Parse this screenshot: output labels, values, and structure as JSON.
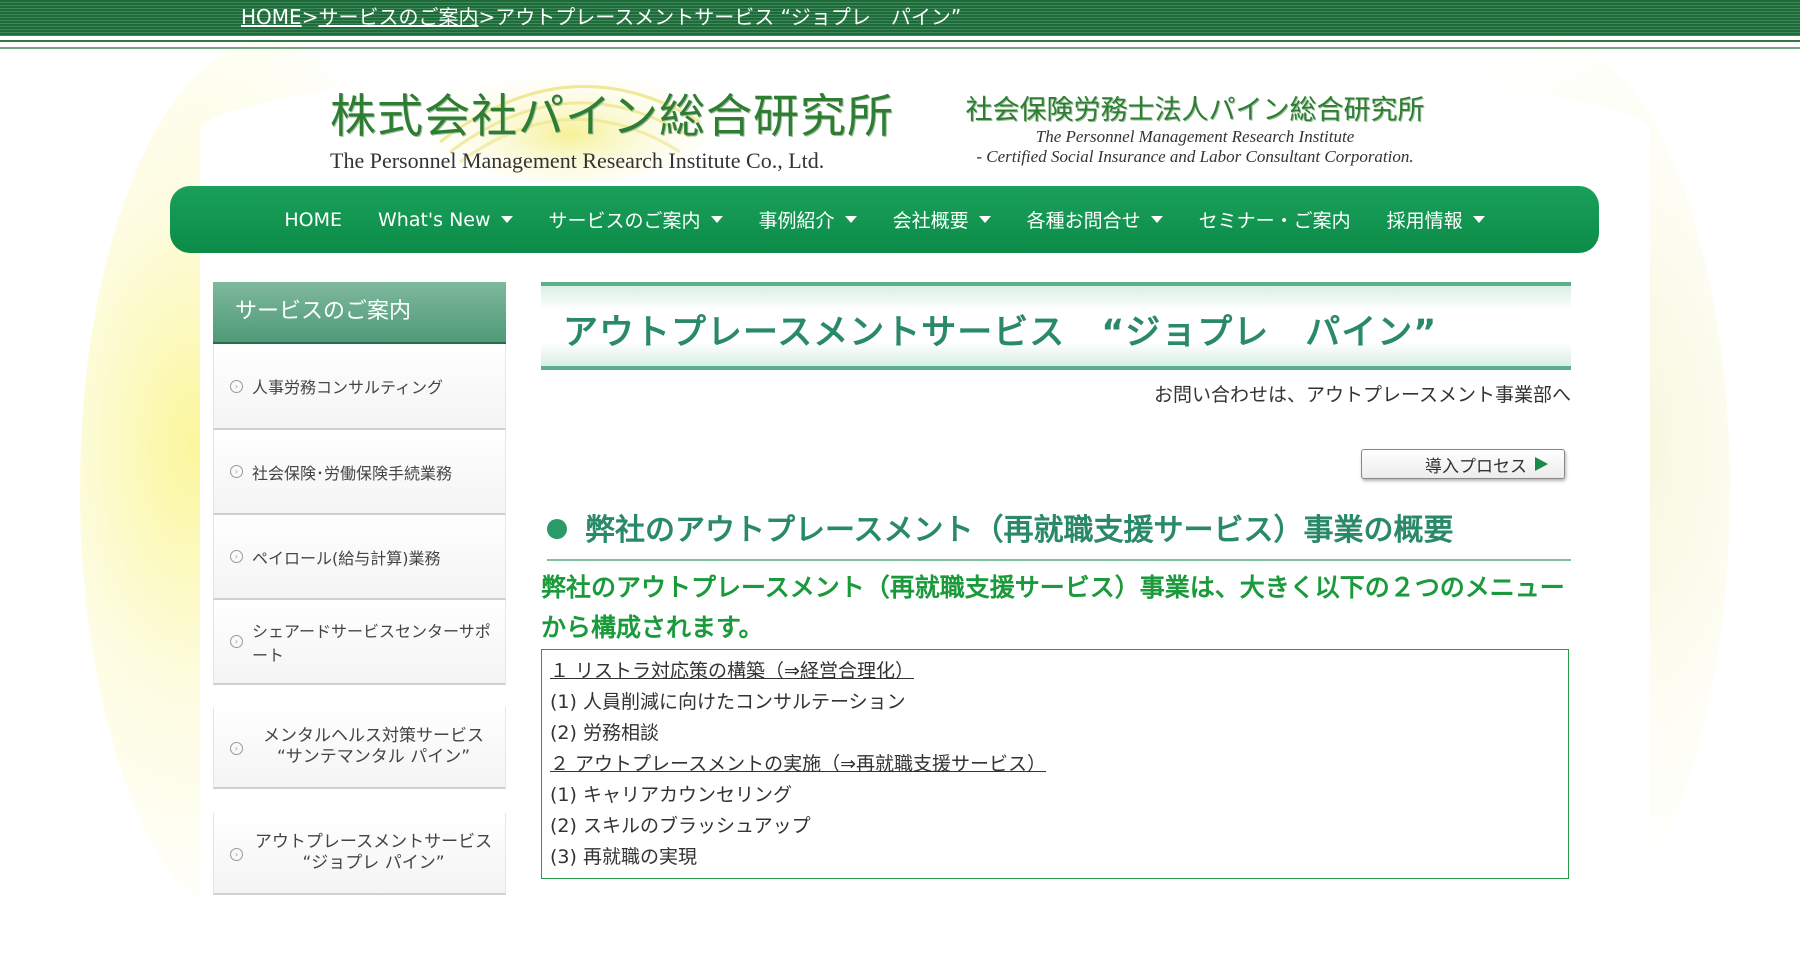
{
  "breadcrumb": {
    "home": "HOME",
    "sep1": ">",
    "services": "サービスのご案内",
    "sep2": ">",
    "current": "アウトプレースメントサービス “ジョプレ　パイン”"
  },
  "header": {
    "company_jp": "株式会社パイン総合研究所",
    "company_en": "The Personnel Management Research Institute Co., Ltd.",
    "corp_jp": "社会保険労務士法人パイン総合研究所",
    "corp_en1": "The Personnel Management Research Institute",
    "corp_en2": "- Certified Social Insurance and Labor Consultant Corporation."
  },
  "nav": {
    "items": [
      {
        "label": "HOME",
        "dropdown": false
      },
      {
        "label": "What's New",
        "dropdown": true
      },
      {
        "label": "サービスのご案内",
        "dropdown": true
      },
      {
        "label": "事例紹介",
        "dropdown": true
      },
      {
        "label": "会社概要",
        "dropdown": true
      },
      {
        "label": "各種お問合せ",
        "dropdown": true
      },
      {
        "label": "セミナー・ご案内",
        "dropdown": false
      },
      {
        "label": "採用情報",
        "dropdown": true
      }
    ]
  },
  "sidebar": {
    "heading": "サービスのご案内",
    "items": [
      {
        "label": "人事労務コンサルティング"
      },
      {
        "label": "社会保険･労働保険手続業務"
      },
      {
        "label": "ペイロール(給与計算)業務"
      },
      {
        "label": "シェアードサービスセンターサポート"
      }
    ],
    "items2": [
      {
        "line1": "メンタルヘルス対策サービス",
        "line2": "“サンテマンタル パイン”"
      },
      {
        "line1": "アウトプレースメントサービス",
        "line2": "“ジョプレ パイン”"
      }
    ]
  },
  "main": {
    "title": "アウトプレースメントサービス　“ジョプレ　パイン”",
    "contact_note": "お問い合わせは、アウトプレースメント事業部へ",
    "process_button": "導入プロセス",
    "section_heading": "弊社のアウトプレースメント（再就職支援サービス）事業の概要",
    "intro": "弊社のアウトプレースメント（再就職支援サービス）事業は、大きく以下の２つのメニューから構成されます。",
    "menu": {
      "head1": "１ リストラ対応策の構築（⇒経営合理化）",
      "item1_1": "(1) 人員削減に向けたコンサルテーション",
      "item1_2": "(2) 労務相談",
      "head2": "２ アウトプレースメントの実施（⇒再就職支援サービス）",
      "item2_1": "(1) キャリアカウンセリング",
      "item2_2": "(2) スキルのブラッシュアップ",
      "item2_3": "(3) 再就職の実現"
    }
  },
  "colors": {
    "brand_green": "#0b8c48",
    "title_green": "#2a8a68",
    "intro_green": "#1a9a3a"
  }
}
